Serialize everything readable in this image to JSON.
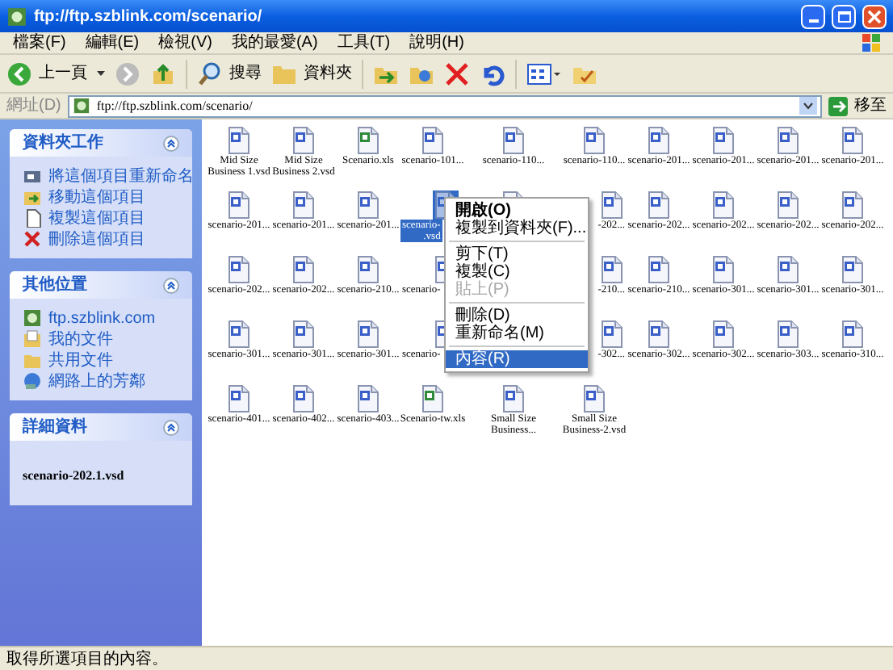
{
  "window": {
    "title": "ftp://ftp.szblink.com/scenario/"
  },
  "menu_bar": [
    "檔案(F)",
    "編輯(E)",
    "檢視(V)",
    "我的最愛(A)",
    "工具(T)",
    "說明(H)"
  ],
  "toolbar": {
    "back": "上一頁",
    "search": "搜尋",
    "folders": "資料夾"
  },
  "address_bar": {
    "label": "網址(D)",
    "value": "ftp://ftp.szblink.com/scenario/",
    "go": "移至"
  },
  "sidebar": [
    {
      "kind": "links",
      "title": "資料夾工作",
      "items": [
        {
          "label": "將這個項目重新命名",
          "kind": "rename"
        },
        {
          "label": "移動這個項目",
          "kind": "move"
        },
        {
          "label": "複製這個項目",
          "kind": "copy"
        },
        {
          "label": "刪除這個項目",
          "kind": "delete"
        }
      ]
    },
    {
      "kind": "links",
      "title": "其他位置",
      "items": [
        {
          "label": "ftp.szblink.com",
          "kind": "ftp"
        },
        {
          "label": "我的文件",
          "kind": "docs"
        },
        {
          "label": "共用文件",
          "kind": "folder"
        },
        {
          "label": "網路上的芳鄰",
          "kind": "network"
        }
      ]
    },
    {
      "kind": "details",
      "title": "詳細資料",
      "text": "scenario-202.1.vsd"
    }
  ],
  "files": [
    {
      "kind": "vsd",
      "lines": [
        "Mid Size",
        "Business 1.vsd"
      ],
      "selected": false,
      "cut_left": false,
      "cut_right": false
    },
    {
      "kind": "vsd",
      "lines": [
        "Mid Size",
        "Business 2.vsd"
      ],
      "selected": false,
      "cut_left": false,
      "cut_right": false
    },
    {
      "kind": "xls",
      "lines": [
        "Scenario.xls"
      ],
      "selected": false,
      "cut_left": false,
      "cut_right": false
    },
    {
      "kind": "vsd",
      "lines": [
        "scenario-101..."
      ],
      "selected": false,
      "cut_left": false,
      "cut_right": false
    },
    {
      "kind": "vsd",
      "lines": [
        "scenario-110..."
      ],
      "selected": false,
      "cut_left": false,
      "cut_right": false
    },
    {
      "kind": "vsd",
      "lines": [
        "scenario-110..."
      ],
      "selected": false,
      "cut_left": false,
      "cut_right": false
    },
    {
      "kind": "vsd",
      "lines": [
        "scenario-201..."
      ],
      "selected": false,
      "cut_left": false,
      "cut_right": false
    },
    {
      "kind": "vsd",
      "lines": [
        "scenario-201..."
      ],
      "selected": false,
      "cut_left": false,
      "cut_right": false
    },
    {
      "kind": "vsd",
      "lines": [
        "scenario-201..."
      ],
      "selected": false,
      "cut_left": false,
      "cut_right": false
    },
    {
      "kind": "vsd",
      "lines": [
        "scenario-201..."
      ],
      "selected": false,
      "cut_left": false,
      "cut_right": false
    },
    {
      "kind": "vsd",
      "lines": [
        "scenario-201..."
      ],
      "selected": false,
      "cut_left": false,
      "cut_right": false
    },
    {
      "kind": "vsd",
      "lines": [
        "scenario-201..."
      ],
      "selected": false,
      "cut_left": false,
      "cut_right": false
    },
    {
      "kind": "vsd",
      "lines": [
        "scenario-201..."
      ],
      "selected": false,
      "cut_left": false,
      "cut_right": false
    },
    {
      "kind": "vsd",
      "lines": [
        "scenario-",
        ".vsd"
      ],
      "selected": true,
      "cut_left": false,
      "cut_right": true
    },
    {
      "kind": "vsd",
      "selected": false,
      "cut_left": false,
      "cut_right": false
    },
    {
      "kind": "vsd",
      "lines": [
        "-202..."
      ],
      "selected": false,
      "cut_left": true,
      "cut_right": false
    },
    {
      "kind": "vsd",
      "lines": [
        "scenario-202..."
      ],
      "selected": false,
      "cut_left": false,
      "cut_right": false
    },
    {
      "kind": "vsd",
      "lines": [
        "scenario-202..."
      ],
      "selected": false,
      "cut_left": false,
      "cut_right": false
    },
    {
      "kind": "vsd",
      "lines": [
        "scenario-202..."
      ],
      "selected": false,
      "cut_left": false,
      "cut_right": false
    },
    {
      "kind": "vsd",
      "lines": [
        "scenario-202..."
      ],
      "selected": false,
      "cut_left": false,
      "cut_right": false
    },
    {
      "kind": "vsd",
      "lines": [
        "scenario-202..."
      ],
      "selected": false,
      "cut_left": false,
      "cut_right": false
    },
    {
      "kind": "vsd",
      "lines": [
        "scenario-202..."
      ],
      "selected": false,
      "cut_left": false,
      "cut_right": false
    },
    {
      "kind": "vsd",
      "lines": [
        "scenario-210..."
      ],
      "selected": false,
      "cut_left": false,
      "cut_right": false
    },
    {
      "kind": "vsd",
      "lines": [
        "scenario-"
      ],
      "selected": false,
      "cut_left": false,
      "cut_right": true
    },
    {
      "kind": "blank"
    },
    {
      "kind": "vsd",
      "lines": [
        "-210..."
      ],
      "selected": false,
      "cut_left": true,
      "cut_right": false
    },
    {
      "kind": "vsd",
      "lines": [
        "scenario-210..."
      ],
      "selected": false,
      "cut_left": false,
      "cut_right": false
    },
    {
      "kind": "vsd",
      "lines": [
        "scenario-301..."
      ],
      "selected": false,
      "cut_left": false,
      "cut_right": false
    },
    {
      "kind": "vsd",
      "lines": [
        "scenario-301..."
      ],
      "selected": false,
      "cut_left": false,
      "cut_right": false
    },
    {
      "kind": "vsd",
      "lines": [
        "scenario-301..."
      ],
      "selected": false,
      "cut_left": false,
      "cut_right": false
    },
    {
      "kind": "vsd",
      "lines": [
        "scenario-301..."
      ],
      "selected": false,
      "cut_left": false,
      "cut_right": false
    },
    {
      "kind": "vsd",
      "lines": [
        "scenario-301..."
      ],
      "selected": false,
      "cut_left": false,
      "cut_right": false
    },
    {
      "kind": "vsd",
      "lines": [
        "scenario-301..."
      ],
      "selected": false,
      "cut_left": false,
      "cut_right": false
    },
    {
      "kind": "vsd",
      "lines": [
        "scenario-"
      ],
      "selected": false,
      "cut_left": false,
      "cut_right": true
    },
    {
      "kind": "blank"
    },
    {
      "kind": "vsd",
      "lines": [
        "-302..."
      ],
      "selected": false,
      "cut_left": true,
      "cut_right": false
    },
    {
      "kind": "vsd",
      "lines": [
        "scenario-302..."
      ],
      "selected": false,
      "cut_left": false,
      "cut_right": false
    },
    {
      "kind": "vsd",
      "lines": [
        "scenario-302..."
      ],
      "selected": false,
      "cut_left": false,
      "cut_right": false
    },
    {
      "kind": "vsd",
      "lines": [
        "scenario-303..."
      ],
      "selected": false,
      "cut_left": false,
      "cut_right": false
    },
    {
      "kind": "vsd",
      "lines": [
        "scenario-310..."
      ],
      "selected": false,
      "cut_left": false,
      "cut_right": false
    },
    {
      "kind": "vsd",
      "lines": [
        "scenario-401..."
      ],
      "selected": false,
      "cut_left": false,
      "cut_right": false
    },
    {
      "kind": "vsd",
      "lines": [
        "scenario-402..."
      ],
      "selected": false,
      "cut_left": false,
      "cut_right": false
    },
    {
      "kind": "vsd",
      "lines": [
        "scenario-403..."
      ],
      "selected": false,
      "cut_left": false,
      "cut_right": false
    },
    {
      "kind": "xls",
      "lines": [
        "Scenario-tw.xls"
      ],
      "selected": false,
      "cut_left": false,
      "cut_right": false
    },
    {
      "kind": "vsd",
      "lines": [
        "Small Size",
        "Business..."
      ],
      "selected": false,
      "cut_left": false,
      "cut_right": false
    },
    {
      "kind": "vsd",
      "lines": [
        "Small Size",
        "Business-2.vsd"
      ],
      "selected": false,
      "cut_left": false,
      "cut_right": false
    }
  ],
  "context_menu": [
    {
      "kind": "item",
      "label": "開啟(O)",
      "bold": true,
      "disabled": false,
      "selected": false
    },
    {
      "kind": "item",
      "label": "複製到資料夾(F)...",
      "bold": false,
      "disabled": false,
      "selected": false
    },
    {
      "kind": "separator"
    },
    {
      "kind": "item",
      "label": "剪下(T)",
      "bold": false,
      "disabled": false,
      "selected": false
    },
    {
      "kind": "item",
      "label": "複製(C)",
      "bold": false,
      "disabled": false,
      "selected": false
    },
    {
      "kind": "item",
      "label": "貼上(P)",
      "bold": false,
      "disabled": true,
      "selected": false
    },
    {
      "kind": "separator"
    },
    {
      "kind": "item",
      "label": "刪除(D)",
      "bold": false,
      "disabled": false,
      "selected": false
    },
    {
      "kind": "item",
      "label": "重新命名(M)",
      "bold": false,
      "disabled": false,
      "selected": false
    },
    {
      "kind": "separator"
    },
    {
      "kind": "item",
      "label": "內容(R)",
      "bold": false,
      "disabled": false,
      "selected": true
    }
  ],
  "status_bar": {
    "text": "取得所選項目的內容。"
  }
}
